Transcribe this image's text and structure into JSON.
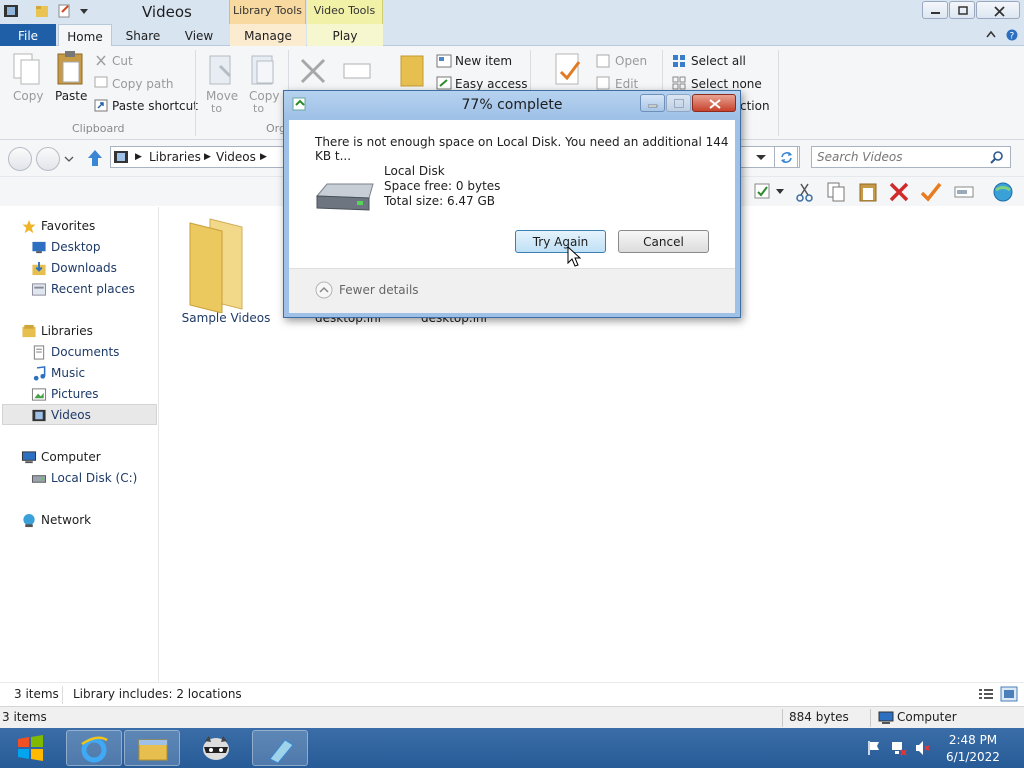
{
  "window": {
    "title": "Videos",
    "ctx_library": "Library Tools",
    "ctx_video": "Video Tools"
  },
  "tabs": {
    "file": "File",
    "home": "Home",
    "share": "Share",
    "view": "View",
    "manage": "Manage",
    "play": "Play"
  },
  "ribbon": {
    "copy": "Copy",
    "paste": "Paste",
    "cut": "Cut",
    "copy_path": "Copy path",
    "paste_shortcut": "Paste shortcut",
    "clipboard": "Clipboard",
    "move_to_1": "Move",
    "move_to_2": "to",
    "copy_to_1": "Copy",
    "copy_to_2": "to",
    "organize_partial": "Org",
    "new_item": "New item",
    "easy_access": "Easy access",
    "open": "Open",
    "edit": "Edit",
    "select_all": "Select all",
    "select_none": "Select none",
    "invert_partial": "ction"
  },
  "address": {
    "crumb1": "Libraries",
    "crumb2": "Videos"
  },
  "search": {
    "placeholder": "Search Videos"
  },
  "nav": {
    "favorites": "Favorites",
    "desktop": "Desktop",
    "downloads": "Downloads",
    "recent": "Recent places",
    "libraries": "Libraries",
    "documents": "Documents",
    "music": "Music",
    "pictures": "Pictures",
    "videos": "Videos",
    "computer": "Computer",
    "local_disk": "Local Disk (C:)",
    "network": "Network"
  },
  "files": [
    {
      "name": "Sample Videos"
    },
    {
      "name": "desktop.ini"
    },
    {
      "name": "desktop.ini"
    }
  ],
  "status": {
    "items": "3 items",
    "includes": "Library includes: 2 locations",
    "items2": "3 items",
    "size": "884 bytes",
    "location": "Computer"
  },
  "dialog": {
    "title": "77% complete",
    "message": "There is not enough space on Local Disk. You need an additional 144 KB t...",
    "disk_name": "Local Disk",
    "space_free": "Space free: 0 bytes",
    "total_size": "Total size: 6.47 GB",
    "try_again": "Try Again",
    "cancel": "Cancel",
    "fewer_details": "Fewer details"
  },
  "taskbar": {
    "time": "2:48 PM",
    "date": "6/1/2022"
  },
  "colors": {
    "file_tab": "#1f5fa8",
    "taskbar": "#2f64a0",
    "dialog_frame": "#9fc1e8"
  }
}
